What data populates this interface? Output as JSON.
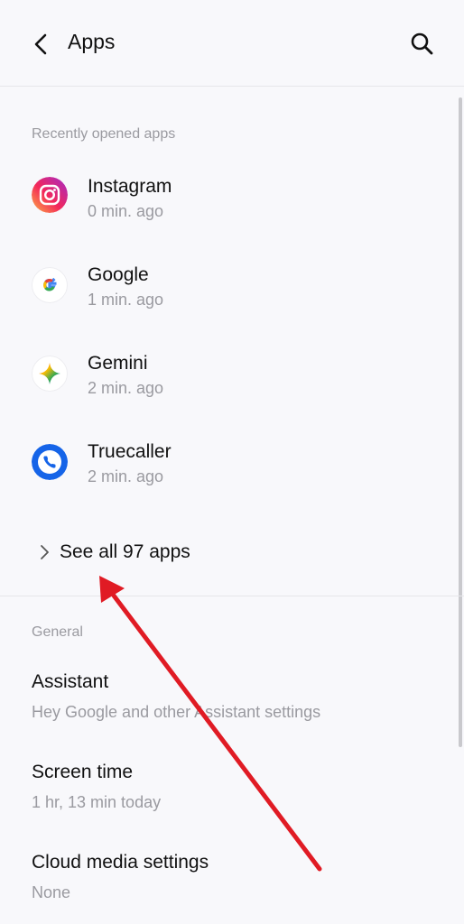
{
  "header": {
    "title": "Apps"
  },
  "recent": {
    "label": "Recently opened apps",
    "apps": [
      {
        "name": "Instagram",
        "time": "0 min. ago",
        "icon": "instagram-icon"
      },
      {
        "name": "Google",
        "time": "1 min. ago",
        "icon": "google-icon"
      },
      {
        "name": "Gemini",
        "time": "2 min. ago",
        "icon": "gemini-icon"
      },
      {
        "name": "Truecaller",
        "time": "2 min. ago",
        "icon": "truecaller-icon"
      }
    ],
    "see_all": "See all 97 apps"
  },
  "general": {
    "label": "General",
    "items": [
      {
        "title": "Assistant",
        "subtitle": "Hey Google and other Assistant settings"
      },
      {
        "title": "Screen time",
        "subtitle": "1 hr, 13 min today"
      },
      {
        "title": "Cloud media settings",
        "subtitle": "None"
      }
    ]
  },
  "annotation": {
    "color": "#e01b24"
  }
}
